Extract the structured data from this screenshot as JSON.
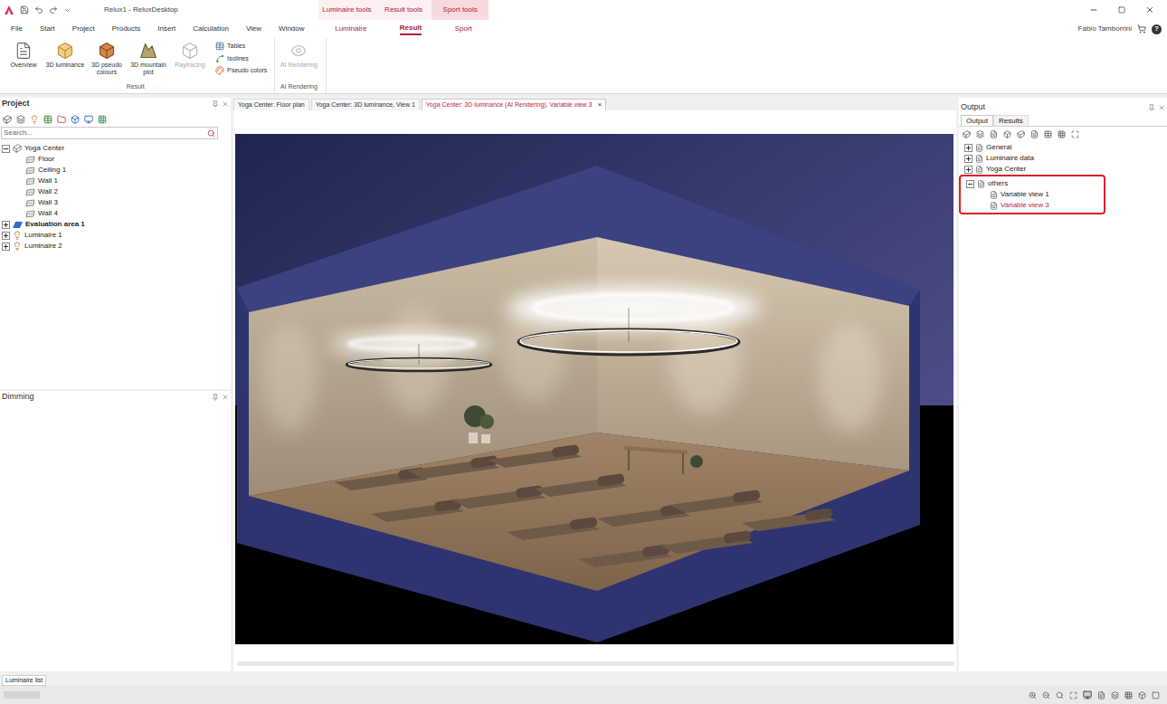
{
  "window": {
    "title": "Relux1 - ReluxDesktop"
  },
  "context_groups": [
    {
      "label": "Luminaire tools",
      "selected": false
    },
    {
      "label": "Result tools",
      "selected": false
    },
    {
      "label": "Sport tools",
      "selected": true
    }
  ],
  "menu_tabs": [
    {
      "label": "File",
      "selected": false,
      "contextual": false
    },
    {
      "label": "Start",
      "selected": false,
      "contextual": false
    },
    {
      "label": "Project",
      "selected": false,
      "contextual": false
    },
    {
      "label": "Products",
      "selected": false,
      "contextual": false
    },
    {
      "label": "Insert",
      "selected": false,
      "contextual": false
    },
    {
      "label": "Calculation",
      "selected": false,
      "contextual": false
    },
    {
      "label": "View",
      "selected": false,
      "contextual": false
    },
    {
      "label": "Window",
      "selected": false,
      "contextual": false
    },
    {
      "label": "Luminaire",
      "selected": false,
      "contextual": true
    },
    {
      "label": "Result",
      "selected": true,
      "contextual": true
    },
    {
      "label": "Sport",
      "selected": false,
      "contextual": true
    }
  ],
  "user": {
    "name": "Fabio Tamborrini",
    "help": "?"
  },
  "ribbon": {
    "groups": [
      {
        "label": "Result",
        "large_buttons": [
          {
            "label": "Overview",
            "kind": "overview",
            "disabled": false
          },
          {
            "label": "3D luminance",
            "kind": "luminance",
            "disabled": false
          },
          {
            "label": "3D pseudo colours",
            "kind": "pseudo",
            "disabled": false
          },
          {
            "label": "3D mountain plot",
            "kind": "mountain",
            "disabled": false
          },
          {
            "label": "Raytracing",
            "kind": "raytracing",
            "disabled": true
          }
        ],
        "small_buttons": [
          {
            "label": "Tables",
            "kind": "tables",
            "disabled": false
          },
          {
            "label": "Isolines",
            "kind": "isolines",
            "disabled": false
          },
          {
            "label": "Pseudo colors",
            "kind": "colors",
            "disabled": false
          }
        ]
      },
      {
        "label": "AI Rendering",
        "large_buttons": [
          {
            "label": "AI Rendering",
            "kind": "ai",
            "disabled": true
          }
        ],
        "small_buttons": []
      }
    ]
  },
  "project_panel": {
    "title": "Project",
    "search_placeholder": "Search...",
    "tree": [
      {
        "label": "Yoga Center",
        "depth": 0,
        "kind": "room",
        "expandable": true,
        "expanded": true,
        "bold": false
      },
      {
        "label": "Floor",
        "depth": 1,
        "kind": "surface",
        "expandable": false,
        "expanded": false,
        "bold": false
      },
      {
        "label": "Ceiling 1",
        "depth": 1,
        "kind": "surface",
        "expandable": false,
        "expanded": false,
        "bold": false
      },
      {
        "label": "Wall 1",
        "depth": 1,
        "kind": "surface",
        "expandable": false,
        "expanded": false,
        "bold": false
      },
      {
        "label": "Wall 2",
        "depth": 1,
        "kind": "surface",
        "expandable": false,
        "expanded": false,
        "bold": false
      },
      {
        "label": "Wall 3",
        "depth": 1,
        "kind": "surface",
        "expandable": false,
        "expanded": false,
        "bold": false
      },
      {
        "label": "Wall 4",
        "depth": 1,
        "kind": "surface",
        "expandable": false,
        "expanded": false,
        "bold": false
      },
      {
        "label": "Evaluation area 1",
        "depth": 0,
        "kind": "evaluation",
        "expandable": true,
        "expanded": false,
        "bold": true
      },
      {
        "label": "Luminaire 1",
        "depth": 0,
        "kind": "luminaire",
        "expandable": true,
        "expanded": false,
        "bold": false
      },
      {
        "label": "Luminaire 2",
        "depth": 0,
        "kind": "luminaire",
        "expandable": true,
        "expanded": false,
        "bold": false
      }
    ]
  },
  "dimming_panel": {
    "title": "Dimming"
  },
  "documents": {
    "close": "×",
    "tabs": [
      {
        "label": "Yoga Center: Floor plan",
        "selected": false
      },
      {
        "label": "Yoga Center: 3D luminance, View 1",
        "selected": false
      },
      {
        "label": "Yoga Center: 3D luminance (AI Rendering), Variable view 3",
        "selected": true
      }
    ]
  },
  "output_panel": {
    "title": "Output",
    "tabs": [
      {
        "label": "Output",
        "selected": true
      },
      {
        "label": "Results",
        "selected": false
      }
    ],
    "tree": [
      {
        "label": "General",
        "depth": 0,
        "expandable": true,
        "expanded": false,
        "selected": false,
        "highlighted": false
      },
      {
        "label": "Luminaire data",
        "depth": 0,
        "expandable": true,
        "expanded": false,
        "selected": false,
        "highlighted": false
      },
      {
        "label": "Yoga Center",
        "depth": 0,
        "expandable": true,
        "expanded": false,
        "selected": false,
        "highlighted": false
      },
      {
        "label": "others",
        "depth": 0,
        "expandable": true,
        "expanded": true,
        "selected": false,
        "highlighted": true
      },
      {
        "label": "Variable view 1",
        "depth": 1,
        "expandable": false,
        "expanded": false,
        "selected": false,
        "highlighted": true
      },
      {
        "label": "Variable view 3",
        "depth": 1,
        "expandable": false,
        "expanded": false,
        "selected": true,
        "highlighted": true
      }
    ]
  },
  "bottom_tabs": [
    {
      "label": "Luminaire list",
      "selected": true
    }
  ]
}
